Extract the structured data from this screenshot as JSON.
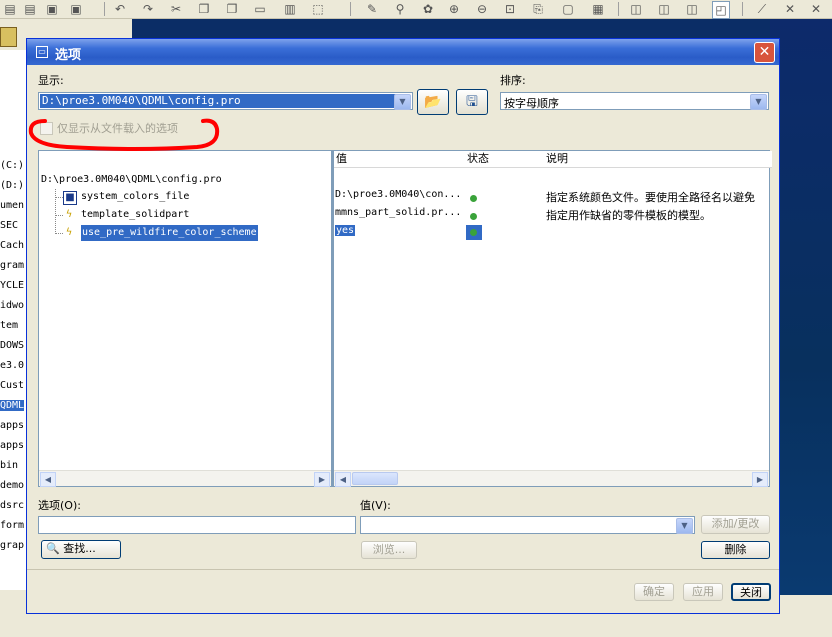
{
  "dialog": {
    "title": "选项",
    "close_glyph": "✕",
    "display_label": "显示:",
    "display_value": "D:\\proe3.0M040\\QDML\\config.pro",
    "sort_label": "排序:",
    "sort_value": "按字母顺序",
    "only_file_checkbox_label": "仅显示从文件载入的选项",
    "tree": {
      "root": "D:\\proe3.0M040\\QDML\\config.pro",
      "items": [
        {
          "name": "system_colors_file",
          "icon": "config-box-icon"
        },
        {
          "name": "template_solidpart",
          "icon": "lightning-icon"
        },
        {
          "name": "use_pre_wildfire_color_scheme",
          "icon": "lightning-icon",
          "selected": true
        }
      ]
    },
    "table": {
      "headers": {
        "value": "值",
        "status": "状态",
        "description": "说明"
      },
      "rows": [
        {
          "value": "D:\\proe3.0M040\\con...",
          "status": "green",
          "description": "指定系统颜色文件。要使用全路径名以避免"
        },
        {
          "value": "mmns_part_solid.pr...",
          "status": "green",
          "description": "指定用作缺省的零件模板的模型。"
        },
        {
          "value": "yes",
          "status": "green",
          "description": ""
        }
      ]
    },
    "option_label": "选项(O):",
    "option_value": "",
    "value_label": "值(V):",
    "value_value": "",
    "add_change_button": "添加/更改",
    "find_button": "查找...",
    "browse_button": "浏览...",
    "delete_button": "删除",
    "ok_button": "确定",
    "apply_button": "应用",
    "close_button": "关闭"
  },
  "background": {
    "left_pane_items": [
      "(C:)",
      "(D:)",
      "umen",
      "SEC",
      "Cach",
      "gram",
      "YCLE",
      "idwo",
      "tem",
      "DOWS",
      "e3.0",
      "Cust",
      "QDML",
      "apps",
      "apps",
      "bin",
      "demo",
      "dsrc",
      "form",
      "grap"
    ]
  },
  "colors": {
    "titlebar": "#2a5cc8",
    "selection": "#316ac5",
    "annotation": "#ff0000",
    "status_green": "#3aa33a"
  }
}
